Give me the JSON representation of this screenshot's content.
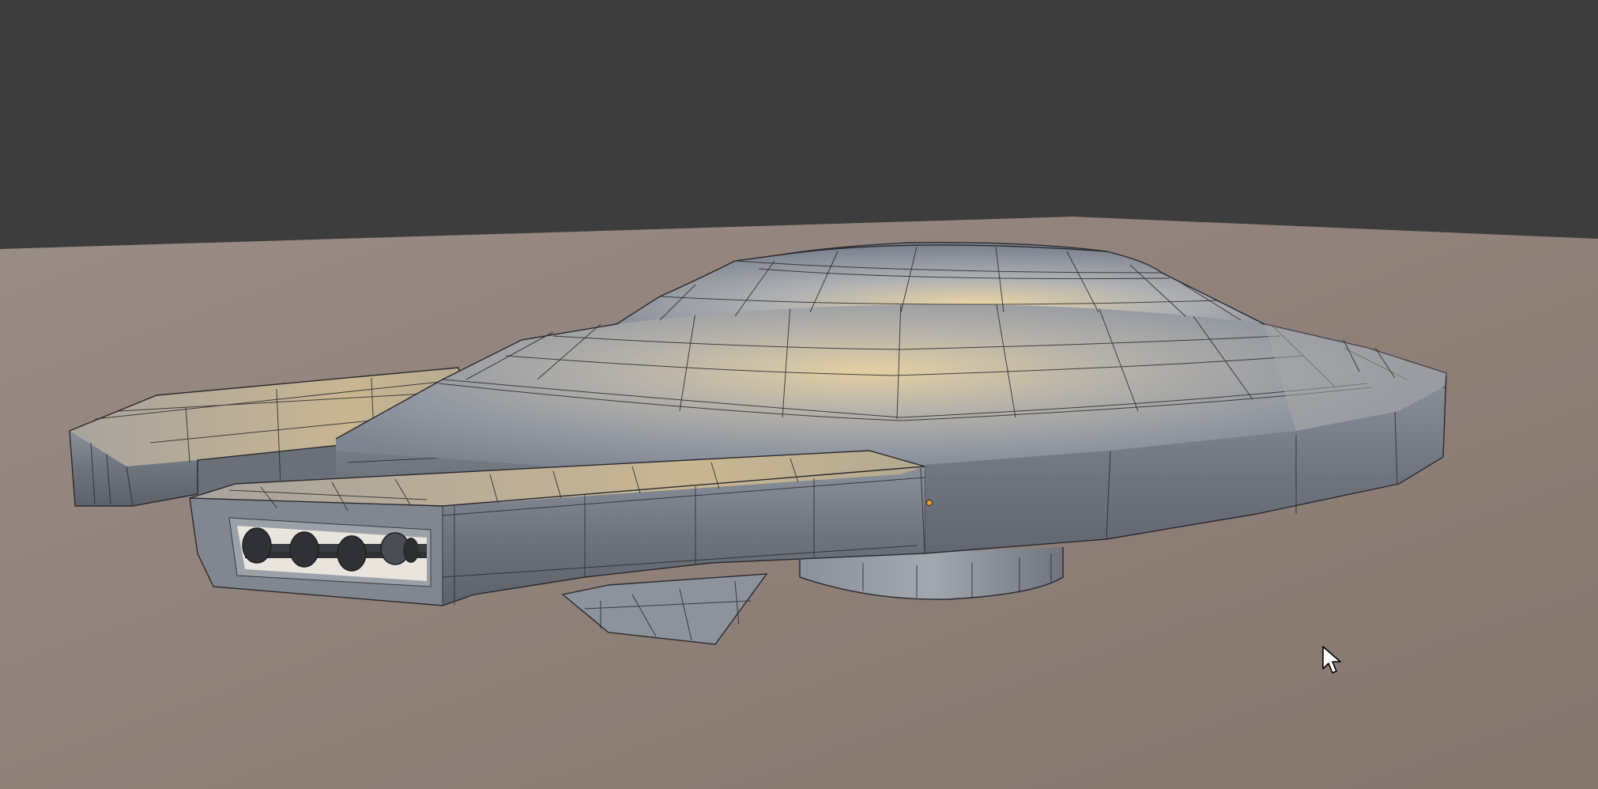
{
  "viewport": {
    "mode": "solid-wireframe-overlay",
    "background_color": "#3d3d3d",
    "ground_color": "#8f8078"
  },
  "model": {
    "icon": "spaceship-mesh",
    "hull_color": "#9aa2ad",
    "highlight_color": "#d9c49a",
    "wire_color": "#2a2a2e",
    "origin_color": "#f0a030"
  },
  "cursor": {
    "icon": "mouse-pointer-icon"
  }
}
